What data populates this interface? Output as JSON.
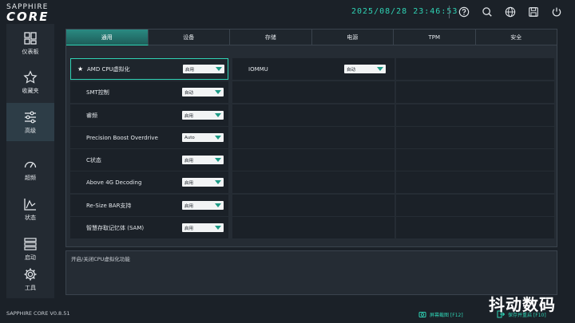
{
  "header": {
    "logo_top": "SAPPHIRE",
    "logo_bottom": "CORE",
    "datetime": "2025/08/28 23:46:53"
  },
  "sidebar": {
    "items": [
      {
        "label": "仪表板",
        "icon": "dashboard-icon"
      },
      {
        "label": "收藏夹",
        "icon": "star-icon"
      },
      {
        "label": "高级",
        "icon": "sliders-icon"
      },
      {
        "label": "超频",
        "icon": "gauge-icon"
      },
      {
        "label": "状态",
        "icon": "chart-icon"
      },
      {
        "label": "启动",
        "icon": "boot-icon"
      },
      {
        "label": "工具",
        "icon": "gear-icon"
      }
    ],
    "version": "SAPPHIRE CORE V0.8.51"
  },
  "tabs": [
    "通用",
    "设备",
    "存储",
    "电源",
    "TPM",
    "安全"
  ],
  "settings": [
    {
      "label": "AMD CPU虚拟化",
      "value": "启用"
    },
    {
      "label": "SMT控制",
      "value": "自动"
    },
    {
      "label": "睿频",
      "value": "启用"
    },
    {
      "label": "Precision Boost Overdrive",
      "value": "Auto"
    },
    {
      "label": "C状态",
      "value": "启用"
    },
    {
      "label": "Above 4G Decoding",
      "value": "启用"
    },
    {
      "label": "Re-Size BAR支持",
      "value": "启用"
    },
    {
      "label": "智慧存取记忆体 (SAM)",
      "value": "启用"
    }
  ],
  "iommu": {
    "label": "IOMMU",
    "value": "自动"
  },
  "description": "开启/关闭CPU虚拟化功能",
  "footer": {
    "screenshot": "屏幕截图 [F12]",
    "save": "保存并重启 [F10]"
  },
  "watermark": "抖动数码",
  "colors": {
    "accent": "#2fd2b4",
    "background": "#1b2128"
  }
}
